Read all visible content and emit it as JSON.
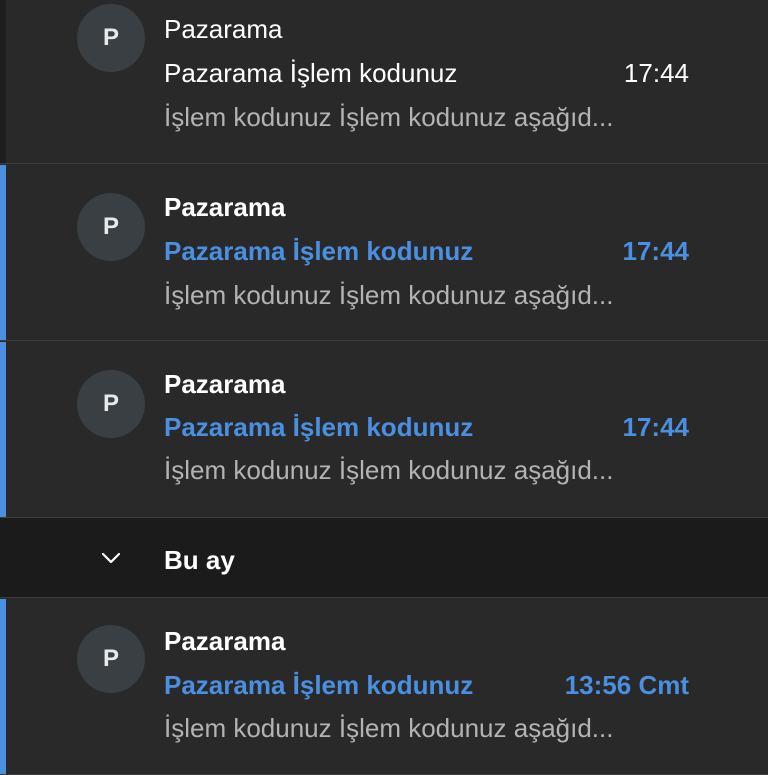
{
  "colors": {
    "background": "#292929",
    "group_header_background": "#1b1b1b",
    "accent_unread": "#4a8fe0",
    "preview_text": "#b3b3b3",
    "avatar_background": "#3a3f44"
  },
  "messages": [
    {
      "avatar_letter": "P",
      "sender": "Pazarama",
      "subject": "Pazarama İşlem kodunuz",
      "time": "17:44",
      "preview": "İşlem kodunuz İşlem kodunuz aşağıd...",
      "unread": false
    },
    {
      "avatar_letter": "P",
      "sender": "Pazarama",
      "subject": "Pazarama İşlem kodunuz",
      "time": "17:44",
      "preview": "İşlem kodunuz İşlem kodunuz aşağıd...",
      "unread": true
    },
    {
      "avatar_letter": "P",
      "sender": "Pazarama",
      "subject": "Pazarama İşlem kodunuz",
      "time": "17:44",
      "preview": "İşlem kodunuz İşlem kodunuz aşağıd...",
      "unread": true
    }
  ],
  "group": {
    "label": "Bu ay",
    "icon": "chevron-down-icon",
    "expanded": true
  },
  "group_messages": [
    {
      "avatar_letter": "P",
      "sender": "Pazarama",
      "subject": "Pazarama İşlem kodunuz",
      "time": "13:56 Cmt",
      "preview": "İşlem kodunuz İşlem kodunuz aşağıd...",
      "unread": true
    }
  ]
}
